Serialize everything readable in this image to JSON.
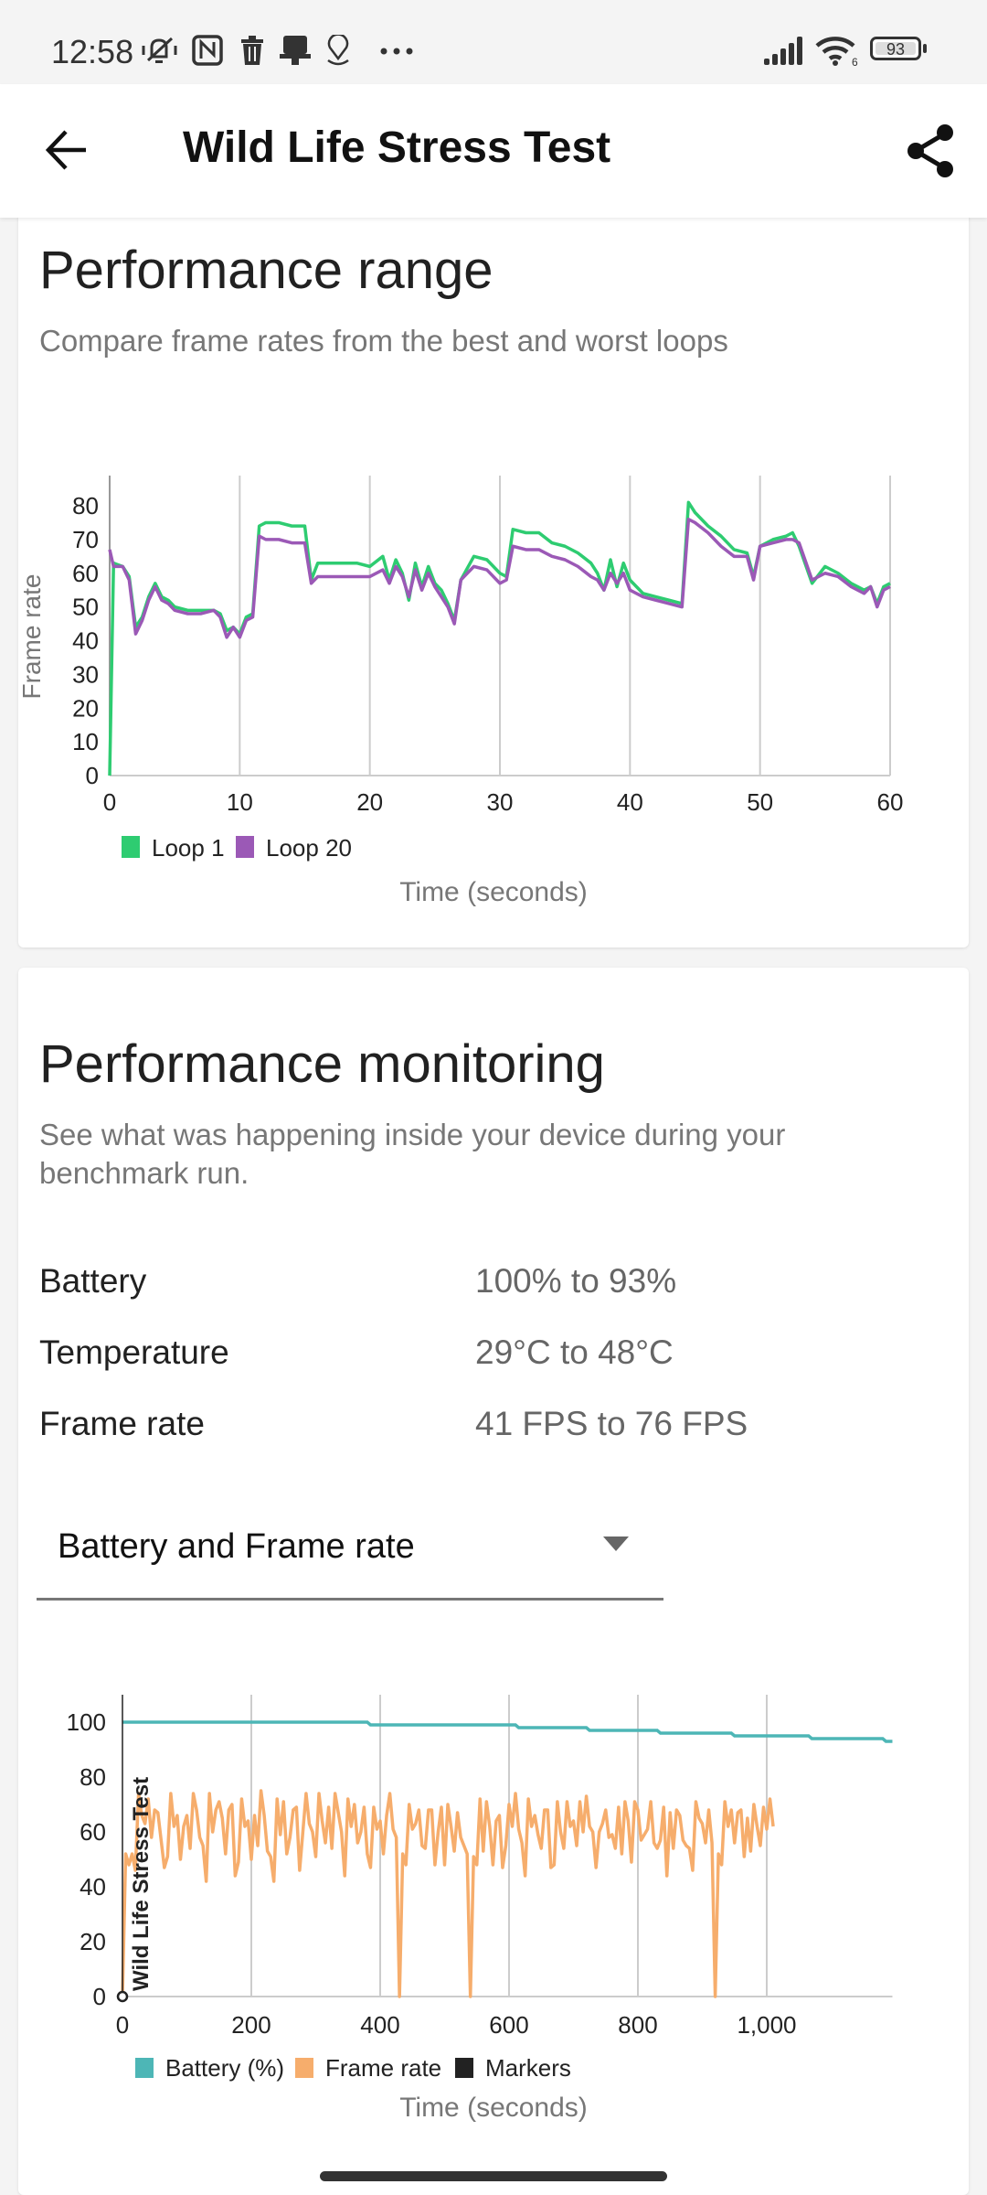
{
  "status_bar": {
    "time": "12:58",
    "left_icons": [
      "vibrate-off-icon",
      "nfc-icon",
      "trash-icon",
      "stamp-icon",
      "location-pin-icon",
      "more-dots-icon"
    ],
    "right_icons": [
      "cellular-signal-icon",
      "wifi-icon",
      "battery-icon"
    ],
    "wifi_label": "6",
    "battery_level": "93"
  },
  "app_bar": {
    "title": "Wild Life Stress Test",
    "back_icon": "arrow-left-icon",
    "share_icon": "share-icon"
  },
  "performance_range": {
    "title": "Performance range",
    "subtitle": "Compare frame rates from the best and worst loops"
  },
  "performance_monitoring": {
    "title": "Performance monitoring",
    "subtitle": "See what was happening inside your device during your benchmark run.",
    "stats": [
      {
        "label": "Battery",
        "value": "100% to 93%"
      },
      {
        "label": "Temperature",
        "value": "29°C to 48°C"
      },
      {
        "label": "Frame rate",
        "value": "41 FPS to 76 FPS"
      }
    ],
    "dropdown": {
      "selected": "Battery and Frame rate"
    }
  },
  "colors": {
    "loop1": "#2ecc71",
    "loop20": "#9b59b6",
    "battery": "#4db6b6",
    "frame_rate": "#f6ad6c",
    "markers": "#222222"
  },
  "chart_data": [
    {
      "type": "line",
      "title": "",
      "xlabel": "Time (seconds)",
      "ylabel": "Frame rate",
      "xlim": [
        0,
        60
      ],
      "ylim": [
        0,
        88
      ],
      "x_ticks": [
        "0",
        "10",
        "20",
        "30",
        "40",
        "50",
        "60"
      ],
      "y_ticks": [
        "0",
        "10",
        "20",
        "30",
        "40",
        "50",
        "60",
        "70",
        "80"
      ],
      "grid": "vertical",
      "legend": "bottom-left",
      "legend_entries": [
        "Loop 1",
        "Loop 20"
      ],
      "x": [
        0,
        0.3,
        1,
        1.5,
        2,
        2.5,
        3,
        3.5,
        4,
        4.5,
        5,
        6,
        7,
        8,
        8.5,
        9,
        9.5,
        10,
        10.5,
        11,
        11.5,
        12,
        13,
        14,
        15,
        15.5,
        16,
        17,
        18,
        19,
        20,
        21,
        21.5,
        22,
        22.5,
        23,
        23.5,
        24,
        24.5,
        25,
        25.5,
        26,
        26.5,
        27,
        28,
        29,
        30,
        30.5,
        31,
        32,
        33,
        34,
        35,
        36,
        37,
        37.5,
        38,
        38.5,
        39,
        39.5,
        40,
        41,
        42,
        43,
        44,
        44.5,
        45,
        46,
        47,
        48,
        49,
        49.5,
        50,
        51,
        52,
        52.5,
        53,
        54,
        55,
        56,
        57,
        58,
        58.5,
        59,
        59.5,
        60
      ],
      "series": [
        {
          "name": "Loop 1",
          "values": [
            0,
            63,
            62,
            59,
            44,
            47,
            53,
            57,
            53,
            52,
            50,
            49,
            49,
            49,
            48,
            43,
            44,
            42,
            47,
            48,
            74,
            75,
            75,
            74,
            74,
            58,
            63,
            63,
            63,
            63,
            62,
            65,
            58,
            64,
            60,
            52,
            63,
            56,
            62,
            57,
            55,
            51,
            46,
            58,
            65,
            64,
            60,
            59,
            73,
            72,
            72,
            69,
            68,
            66,
            63,
            60,
            55,
            64,
            56,
            63,
            58,
            54,
            53,
            52,
            51,
            81,
            78,
            74,
            71,
            67,
            66,
            59,
            68,
            70,
            71,
            72,
            68,
            57,
            62,
            60,
            57,
            55,
            56,
            51,
            56,
            57,
            52
          ]
        },
        {
          "name": "Loop 20",
          "values": [
            67,
            62,
            62,
            58,
            42,
            46,
            52,
            56,
            52,
            51,
            49,
            48,
            48,
            49,
            47,
            41,
            44,
            41,
            46,
            47,
            71,
            70,
            70,
            69,
            69,
            57,
            59,
            59,
            59,
            59,
            59,
            61,
            57,
            62,
            59,
            53,
            61,
            55,
            60,
            56,
            53,
            50,
            45,
            58,
            62,
            61,
            57,
            58,
            68,
            67,
            67,
            65,
            64,
            62,
            59,
            58,
            55,
            60,
            57,
            60,
            55,
            53,
            52,
            51,
            50,
            76,
            75,
            72,
            68,
            65,
            65,
            58,
            68,
            69,
            70,
            70,
            69,
            58,
            60,
            59,
            56,
            54,
            56,
            50,
            55,
            56,
            56
          ]
        }
      ]
    },
    {
      "type": "line",
      "title": "",
      "xlabel": "Time (seconds)",
      "ylabel": "",
      "xlim": [
        0,
        1195
      ],
      "ylim": [
        0,
        110
      ],
      "x_ticks": [
        "0",
        "200",
        "400",
        "600",
        "800",
        "1,000"
      ],
      "y_ticks": [
        "0",
        "20",
        "40",
        "60",
        "80",
        "100"
      ],
      "grid": "vertical",
      "legend": "bottom-left",
      "legend_entries": [
        "Battery (%)",
        "Frame rate",
        "Markers"
      ],
      "annotations": [
        {
          "x": 0,
          "label": "Wild Life Stress Test"
        }
      ],
      "series": [
        {
          "name": "Battery (%)",
          "x": [
            0,
            380,
            385,
            610,
            615,
            720,
            725,
            830,
            835,
            945,
            950,
            1065,
            1070,
            1180,
            1185,
            1195
          ],
          "values": [
            100,
            100,
            99,
            99,
            98,
            98,
            97,
            97,
            96,
            96,
            95,
            95,
            94,
            94,
            93,
            93
          ]
        },
        {
          "name": "Frame rate",
          "x_step": 5,
          "values": [
            0,
            52,
            48,
            52,
            46,
            74,
            66,
            63,
            72,
            58,
            68,
            67,
            57,
            47,
            51,
            74,
            62,
            66,
            50,
            62,
            66,
            54,
            74,
            68,
            58,
            55,
            42,
            74,
            60,
            68,
            71,
            65,
            52,
            68,
            70,
            44,
            49,
            72,
            62,
            64,
            50,
            66,
            55,
            75,
            66,
            53,
            51,
            42,
            72,
            59,
            71,
            52,
            58,
            68,
            69,
            46,
            60,
            74,
            63,
            60,
            51,
            74,
            64,
            56,
            69,
            54,
            74,
            67,
            60,
            44,
            72,
            62,
            70,
            56,
            60,
            69,
            52,
            47,
            69,
            61,
            64,
            52,
            66,
            74,
            61,
            58,
            0,
            52,
            48,
            70,
            61,
            63,
            68,
            55,
            54,
            68,
            68,
            48,
            60,
            69,
            48,
            70,
            62,
            53,
            67,
            58,
            55,
            52,
            0,
            51,
            48,
            72,
            53,
            71,
            62,
            48,
            64,
            66,
            47,
            55,
            70,
            62,
            74,
            61,
            56,
            44,
            72,
            62,
            66,
            59,
            54,
            68,
            68,
            47,
            48,
            71,
            60,
            54,
            71,
            62,
            64,
            55,
            71,
            60,
            73,
            62,
            60,
            47,
            60,
            63,
            68,
            58,
            59,
            54,
            69,
            52,
            71,
            64,
            49,
            71,
            68,
            57,
            59,
            61,
            71,
            56,
            54,
            57,
            69,
            44,
            67,
            54,
            68,
            66,
            57,
            55,
            54,
            46,
            71,
            65,
            63,
            56,
            68,
            56,
            0,
            52,
            48,
            71,
            62,
            68,
            56,
            67,
            68,
            51,
            65,
            53,
            70,
            62,
            55,
            69,
            61,
            72,
            62
          ]
        }
      ]
    }
  ]
}
